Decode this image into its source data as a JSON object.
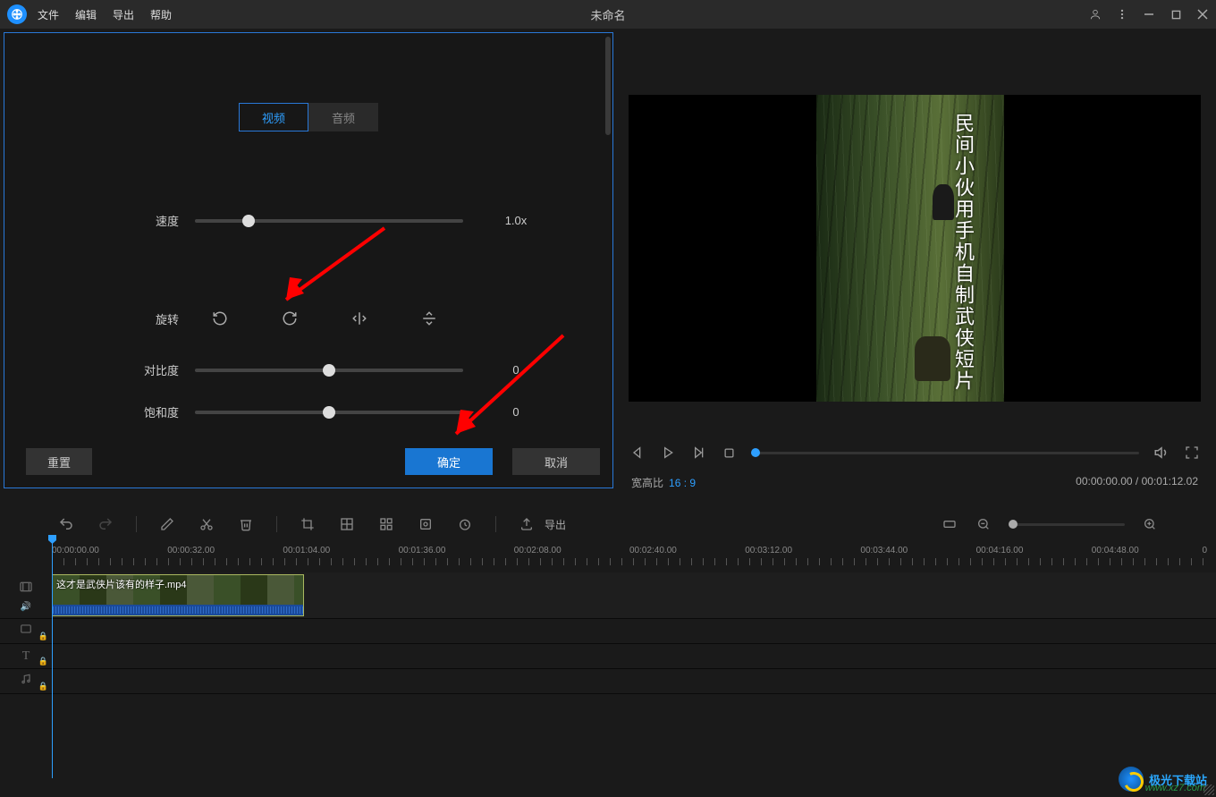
{
  "titlebar": {
    "menus": [
      "文件",
      "编辑",
      "导出",
      "帮助"
    ],
    "title": "未命名"
  },
  "settings": {
    "tab_video": "视频",
    "tab_audio": "音频",
    "speed_label": "速度",
    "speed_value": "1.0x",
    "rotate_label": "旋转",
    "contrast_label": "对比度",
    "contrast_value": "0",
    "saturation_label": "饱和度",
    "saturation_value": "0",
    "reset": "重置",
    "ok": "确定",
    "cancel": "取消"
  },
  "preview": {
    "caption": "民间小伙用手机自制武侠短片",
    "aspect_label": "宽高比",
    "aspect_value": "16 : 9",
    "time_current": "00:00:00.00",
    "time_total": "00:01:12.02"
  },
  "toolbar": {
    "export": "导出"
  },
  "ruler": {
    "marks": [
      "00:00:00.00",
      "00:00:32.00",
      "00:01:04.00",
      "00:01:36.00",
      "00:02:08.00",
      "00:02:40.00",
      "00:03:12.00",
      "00:03:44.00",
      "00:04:16.00",
      "00:04:48.00"
    ],
    "end": "0"
  },
  "clip": {
    "name": "这才是武侠片该有的样子.mp4"
  },
  "watermark": {
    "name": "极光下载站",
    "url": "www.xz7.com"
  }
}
